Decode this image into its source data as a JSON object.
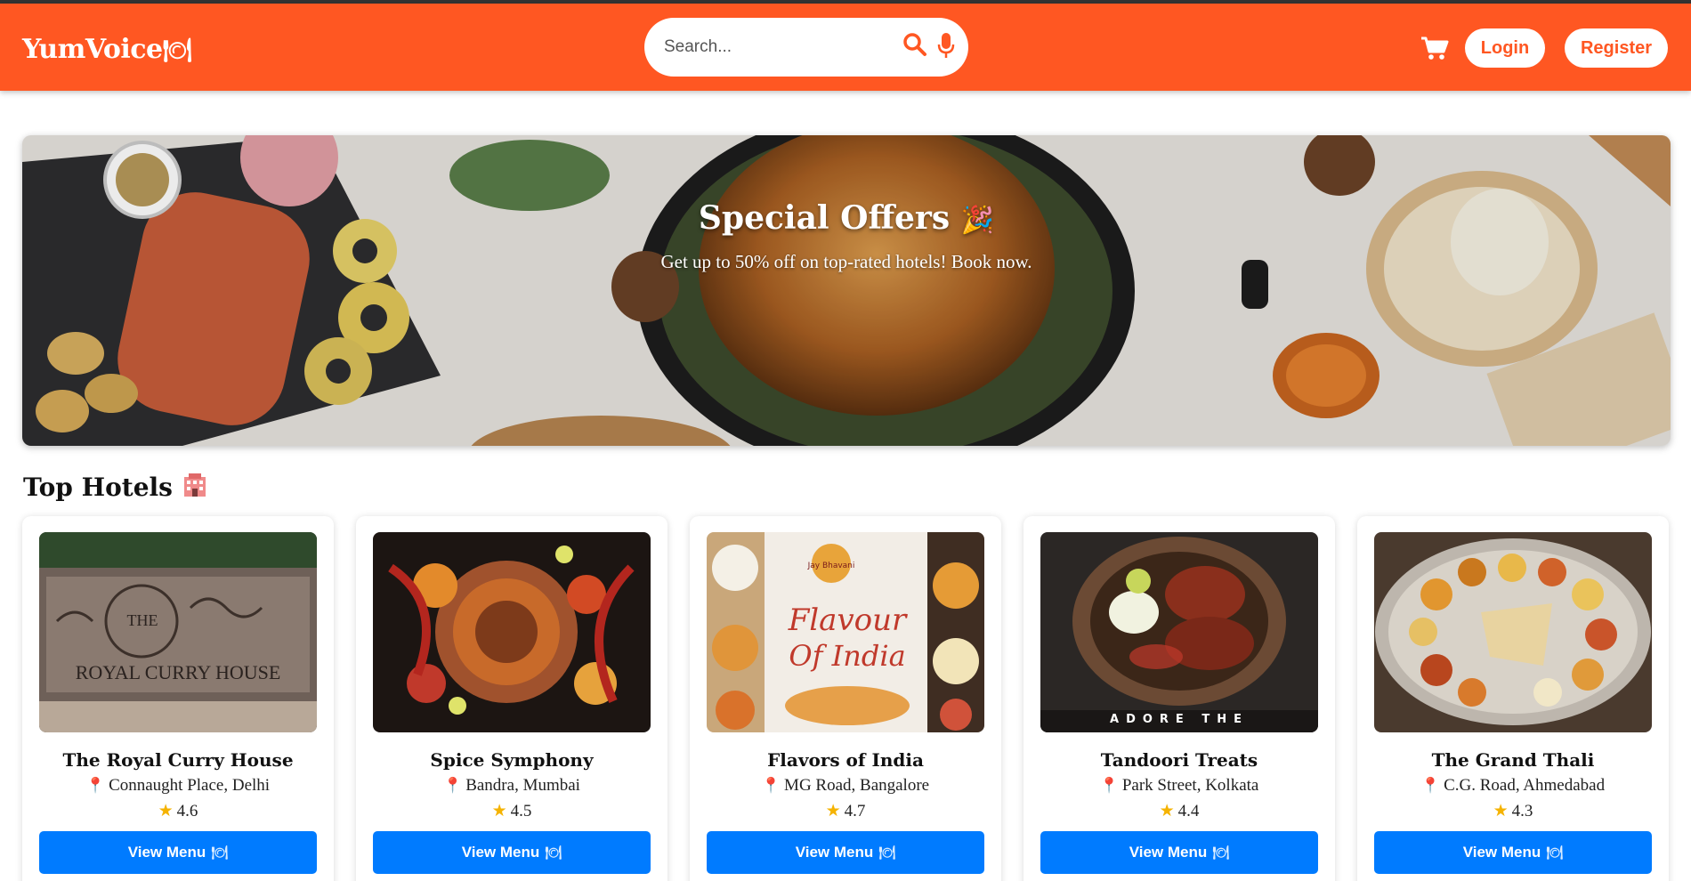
{
  "app": {
    "logo_text": "YumVoice",
    "logo_icon": "plate-cutlery-icon"
  },
  "header": {
    "search_placeholder": "Search...",
    "search_icon": "search-icon",
    "mic_icon": "microphone-icon",
    "cart_icon": "cart-icon",
    "login_label": "Login",
    "register_label": "Register"
  },
  "banner": {
    "title": "Special Offers",
    "title_icon": "party-popper-icon",
    "subtitle": "Get up to 50% off on top-rated hotels! Book now."
  },
  "top_hotels": {
    "title": "Top Hotels",
    "title_icon": "hotel-icon",
    "hotels": [
      {
        "name": "The Royal Curry House",
        "location": "Connaught Place, Delhi",
        "rating": "4.6",
        "button": "View Menu"
      },
      {
        "name": "Spice Symphony",
        "location": "Bandra, Mumbai",
        "rating": "4.5",
        "button": "View Menu"
      },
      {
        "name": "Flavors of India",
        "location": "MG Road, Bangalore",
        "rating": "4.7",
        "button": "View Menu"
      },
      {
        "name": "Tandoori Treats",
        "location": "Park Street, Kolkata",
        "rating": "4.4",
        "button": "View Menu"
      },
      {
        "name": "The Grand Thali",
        "location": "C.G. Road, Ahmedabad",
        "rating": "4.3",
        "button": "View Menu"
      }
    ]
  },
  "image_text": {
    "sign_line1": "THE",
    "sign_line2": "ROYAL CURRY HOUSE",
    "flavour_line1": "Flavour",
    "flavour_line2": "Of India",
    "tandoori_caption": "ADORE THE"
  },
  "colors": {
    "brand": "#ff5722",
    "button": "#007bff",
    "pin": "#e91e63",
    "star": "#f5b301"
  }
}
